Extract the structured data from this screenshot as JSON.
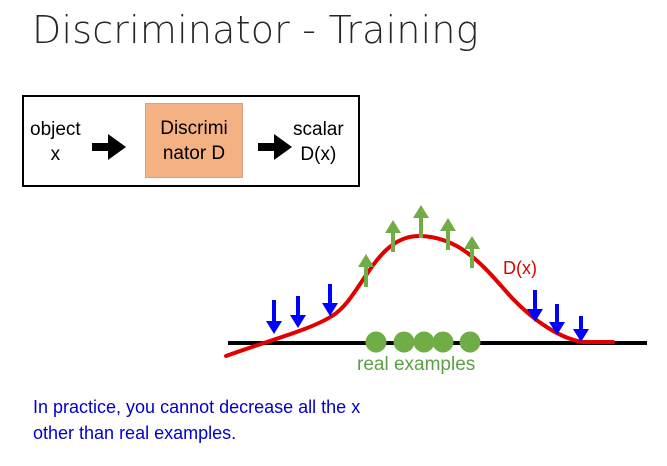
{
  "title": "Discriminator - Training",
  "pipeline": {
    "input_line1": "object",
    "input_line2": "x",
    "discriminator_line1": "Discrimi",
    "discriminator_line2": "nator D",
    "output_line1": "scalar",
    "output_line2": "D(x)"
  },
  "graph": {
    "curve_label": "D(x)",
    "points_label": "real examples",
    "up_arrows": 5,
    "down_arrows": 6,
    "real_example_count": 5
  },
  "caption": {
    "line1": "In practice, you cannot decrease all the x",
    "line2": "other than real examples."
  },
  "colors": {
    "curve": "#e00000",
    "up_arrow": "#70ad47",
    "down_arrow": "#0000ff",
    "real_point": "#70ad47",
    "discriminator_fill": "#f4b183",
    "caption": "#0000cc"
  }
}
